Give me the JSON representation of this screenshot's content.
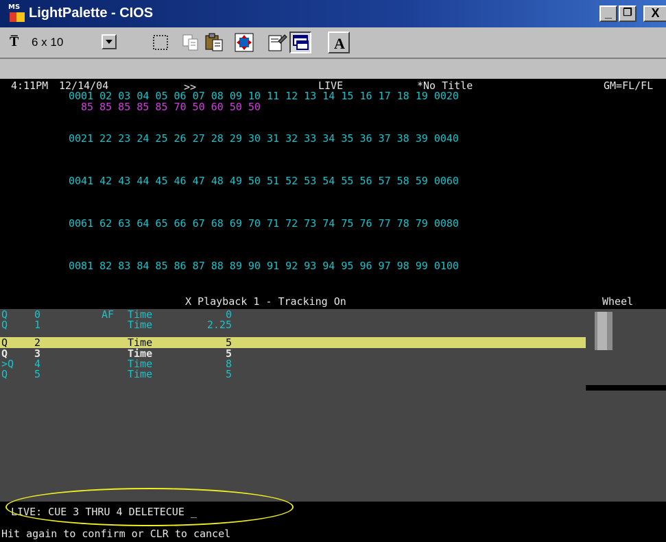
{
  "window": {
    "logo_text": "MS",
    "title": "LightPalette - CIOS",
    "minimize": "_",
    "restore": "❐",
    "close": "X"
  },
  "toolbar": {
    "font_icon": "T̅",
    "font_select": "6 x 10",
    "font_button": "A",
    "icons": [
      "select-icon",
      "copy-icon",
      "paste-icon",
      "move-icon",
      "properties-icon",
      "window-icon",
      "font-icon"
    ]
  },
  "status": {
    "time": "4:11PM",
    "date": "12/14/04",
    "arrows": ">>",
    "mode": "LIVE",
    "title": "*No Title",
    "gm": "GM=FL/FL"
  },
  "channels": {
    "rows": [
      "0001 02 03 04 05 06 07 08 09 10 11 12 13 14 15 16 17 18 19 0020",
      "0021 22 23 24 25 26 27 28 29 30 31 32 33 34 35 36 37 38 39 0040",
      "0041 42 43 44 45 46 47 48 49 50 51 52 53 54 55 56 57 58 59 0060",
      "0061 62 63 64 65 66 67 68 69 70 71 72 73 74 75 76 77 78 79 0080",
      "0081 82 83 84 85 86 87 88 89 90 91 92 93 94 95 96 97 98 99 0100"
    ],
    "levels_row1": "85 85 85 85 85 70 50 60 50 50"
  },
  "playback": {
    "header": "X Playback 1 - Tracking On",
    "wheel_label": "Wheel",
    "cues": [
      {
        "q": "Q",
        "num": "0",
        "flags": "AF",
        "label": "Time",
        "value": "0"
      },
      {
        "q": "Q",
        "num": "1",
        "flags": "",
        "label": "Time",
        "value": "2.25"
      },
      {
        "q": "Q",
        "num": "2",
        "flags": "",
        "label": "Time",
        "value": "5"
      },
      {
        "q": "Q",
        "num": "3",
        "flags": "",
        "label": "Time",
        "value": "5"
      },
      {
        "q": ">Q",
        "num": "4",
        "flags": "",
        "label": "Time",
        "value": "8"
      },
      {
        "q": "Q",
        "num": "5",
        "flags": "",
        "label": "Time",
        "value": "5"
      }
    ]
  },
  "command": {
    "line": "LIVE: CUE 3 THRU 4 DELETECUE _",
    "message": "Hit again to confirm or CLR to cancel"
  },
  "colors": {
    "cyan": "#19c4cc",
    "magenta": "#d040e0",
    "highlight": "#d8d870",
    "title_bar": "#0a246a"
  }
}
